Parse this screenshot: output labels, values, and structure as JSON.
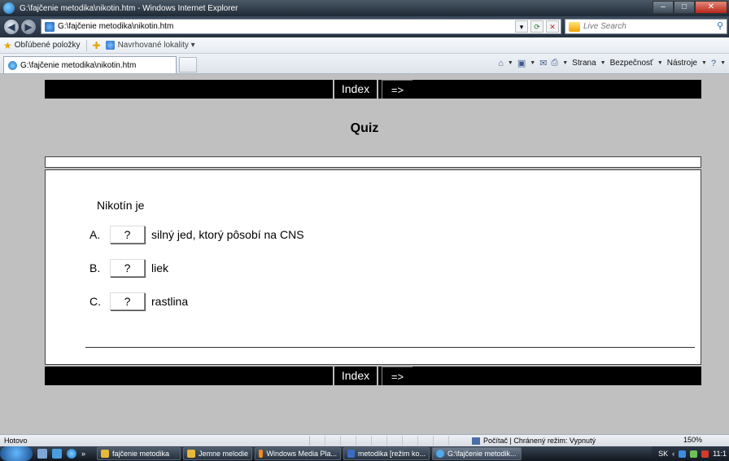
{
  "window": {
    "title": "G:\\fajčenie metodika\\nikotin.htm - Windows Internet Explorer",
    "minimize": "–",
    "maximize": "□",
    "close": "✕"
  },
  "address_bar": {
    "url": "G:\\fajčenie metodika\\nikotin.htm",
    "search_placeholder": "Live Search"
  },
  "favorites_bar": {
    "favorites_label": "Obľúbené položky",
    "suggested_label": "Navrhované lokality ▾"
  },
  "tabs": [
    {
      "label": "G:\\fajčenie metodika\\nikotin.htm"
    }
  ],
  "command_bar": {
    "page": "Strana",
    "safety": "Bezpečnosť",
    "tools": "Nástroje"
  },
  "page": {
    "nav": {
      "index": "Index",
      "next": "=>"
    },
    "title": "Quiz",
    "question": "Nikotín je",
    "answers": [
      {
        "letter": "A.",
        "button": "?",
        "text": "silný jed, ktorý pôsobí na CNS"
      },
      {
        "letter": "B.",
        "button": "?",
        "text": "liek"
      },
      {
        "letter": "C.",
        "button": "?",
        "text": "rastlina"
      }
    ]
  },
  "status_bar": {
    "status": "Hotovo",
    "zone": "Počítač | Chránený režim: Vypnutý",
    "zoom": "150%"
  },
  "taskbar": {
    "more": "»",
    "tasks": [
      "fajčenie metodika",
      "Jemne melodie",
      "Windows Media Pla...",
      "metodika [režim ko...",
      "G:\\fajčenie metodik..."
    ],
    "language": "SK",
    "clock": "11:1"
  }
}
